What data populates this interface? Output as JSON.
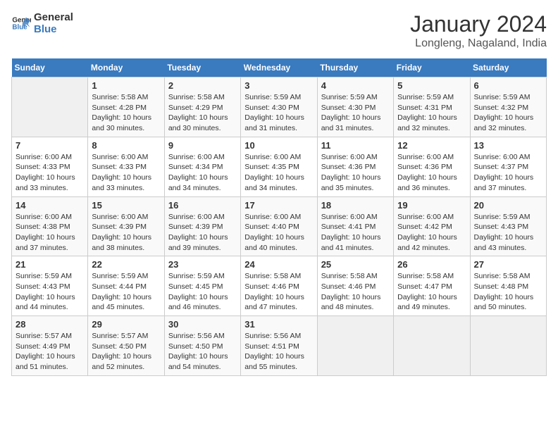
{
  "header": {
    "logo_line1": "General",
    "logo_line2": "Blue",
    "month": "January 2024",
    "location": "Longleng, Nagaland, India"
  },
  "days_of_week": [
    "Sunday",
    "Monday",
    "Tuesday",
    "Wednesday",
    "Thursday",
    "Friday",
    "Saturday"
  ],
  "weeks": [
    [
      {
        "day": "",
        "info": ""
      },
      {
        "day": "1",
        "info": "Sunrise: 5:58 AM\nSunset: 4:28 PM\nDaylight: 10 hours\nand 30 minutes."
      },
      {
        "day": "2",
        "info": "Sunrise: 5:58 AM\nSunset: 4:29 PM\nDaylight: 10 hours\nand 30 minutes."
      },
      {
        "day": "3",
        "info": "Sunrise: 5:59 AM\nSunset: 4:30 PM\nDaylight: 10 hours\nand 31 minutes."
      },
      {
        "day": "4",
        "info": "Sunrise: 5:59 AM\nSunset: 4:30 PM\nDaylight: 10 hours\nand 31 minutes."
      },
      {
        "day": "5",
        "info": "Sunrise: 5:59 AM\nSunset: 4:31 PM\nDaylight: 10 hours\nand 32 minutes."
      },
      {
        "day": "6",
        "info": "Sunrise: 5:59 AM\nSunset: 4:32 PM\nDaylight: 10 hours\nand 32 minutes."
      }
    ],
    [
      {
        "day": "7",
        "info": "Sunrise: 6:00 AM\nSunset: 4:33 PM\nDaylight: 10 hours\nand 33 minutes."
      },
      {
        "day": "8",
        "info": "Sunrise: 6:00 AM\nSunset: 4:33 PM\nDaylight: 10 hours\nand 33 minutes."
      },
      {
        "day": "9",
        "info": "Sunrise: 6:00 AM\nSunset: 4:34 PM\nDaylight: 10 hours\nand 34 minutes."
      },
      {
        "day": "10",
        "info": "Sunrise: 6:00 AM\nSunset: 4:35 PM\nDaylight: 10 hours\nand 34 minutes."
      },
      {
        "day": "11",
        "info": "Sunrise: 6:00 AM\nSunset: 4:36 PM\nDaylight: 10 hours\nand 35 minutes."
      },
      {
        "day": "12",
        "info": "Sunrise: 6:00 AM\nSunset: 4:36 PM\nDaylight: 10 hours\nand 36 minutes."
      },
      {
        "day": "13",
        "info": "Sunrise: 6:00 AM\nSunset: 4:37 PM\nDaylight: 10 hours\nand 37 minutes."
      }
    ],
    [
      {
        "day": "14",
        "info": "Sunrise: 6:00 AM\nSunset: 4:38 PM\nDaylight: 10 hours\nand 37 minutes."
      },
      {
        "day": "15",
        "info": "Sunrise: 6:00 AM\nSunset: 4:39 PM\nDaylight: 10 hours\nand 38 minutes."
      },
      {
        "day": "16",
        "info": "Sunrise: 6:00 AM\nSunset: 4:39 PM\nDaylight: 10 hours\nand 39 minutes."
      },
      {
        "day": "17",
        "info": "Sunrise: 6:00 AM\nSunset: 4:40 PM\nDaylight: 10 hours\nand 40 minutes."
      },
      {
        "day": "18",
        "info": "Sunrise: 6:00 AM\nSunset: 4:41 PM\nDaylight: 10 hours\nand 41 minutes."
      },
      {
        "day": "19",
        "info": "Sunrise: 6:00 AM\nSunset: 4:42 PM\nDaylight: 10 hours\nand 42 minutes."
      },
      {
        "day": "20",
        "info": "Sunrise: 5:59 AM\nSunset: 4:43 PM\nDaylight: 10 hours\nand 43 minutes."
      }
    ],
    [
      {
        "day": "21",
        "info": "Sunrise: 5:59 AM\nSunset: 4:43 PM\nDaylight: 10 hours\nand 44 minutes."
      },
      {
        "day": "22",
        "info": "Sunrise: 5:59 AM\nSunset: 4:44 PM\nDaylight: 10 hours\nand 45 minutes."
      },
      {
        "day": "23",
        "info": "Sunrise: 5:59 AM\nSunset: 4:45 PM\nDaylight: 10 hours\nand 46 minutes."
      },
      {
        "day": "24",
        "info": "Sunrise: 5:58 AM\nSunset: 4:46 PM\nDaylight: 10 hours\nand 47 minutes."
      },
      {
        "day": "25",
        "info": "Sunrise: 5:58 AM\nSunset: 4:46 PM\nDaylight: 10 hours\nand 48 minutes."
      },
      {
        "day": "26",
        "info": "Sunrise: 5:58 AM\nSunset: 4:47 PM\nDaylight: 10 hours\nand 49 minutes."
      },
      {
        "day": "27",
        "info": "Sunrise: 5:58 AM\nSunset: 4:48 PM\nDaylight: 10 hours\nand 50 minutes."
      }
    ],
    [
      {
        "day": "28",
        "info": "Sunrise: 5:57 AM\nSunset: 4:49 PM\nDaylight: 10 hours\nand 51 minutes."
      },
      {
        "day": "29",
        "info": "Sunrise: 5:57 AM\nSunset: 4:50 PM\nDaylight: 10 hours\nand 52 minutes."
      },
      {
        "day": "30",
        "info": "Sunrise: 5:56 AM\nSunset: 4:50 PM\nDaylight: 10 hours\nand 54 minutes."
      },
      {
        "day": "31",
        "info": "Sunrise: 5:56 AM\nSunset: 4:51 PM\nDaylight: 10 hours\nand 55 minutes."
      },
      {
        "day": "",
        "info": ""
      },
      {
        "day": "",
        "info": ""
      },
      {
        "day": "",
        "info": ""
      }
    ]
  ]
}
